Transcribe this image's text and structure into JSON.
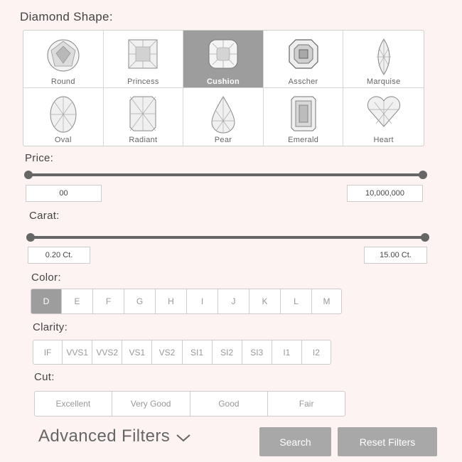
{
  "shape": {
    "title": "Diamond Shape:",
    "items": [
      {
        "label": "Round",
        "icon": "round-diamond-icon"
      },
      {
        "label": "Princess",
        "icon": "princess-diamond-icon"
      },
      {
        "label": "Cushion",
        "icon": "cushion-diamond-icon",
        "selected": true
      },
      {
        "label": "Asscher",
        "icon": "asscher-diamond-icon"
      },
      {
        "label": "Marquise",
        "icon": "marquise-diamond-icon"
      },
      {
        "label": "Oval",
        "icon": "oval-diamond-icon"
      },
      {
        "label": "Radiant",
        "icon": "radiant-diamond-icon"
      },
      {
        "label": "Pear",
        "icon": "pear-diamond-icon"
      },
      {
        "label": "Emerald",
        "icon": "emerald-diamond-icon"
      },
      {
        "label": "Heart",
        "icon": "heart-diamond-icon"
      }
    ]
  },
  "price": {
    "title": "Price:",
    "min_value": "00",
    "max_value": "10,000,000"
  },
  "carat": {
    "title": "Carat:",
    "min_value": "0.20 Ct.",
    "max_value": "15.00 Ct."
  },
  "color": {
    "title": "Color:",
    "options": [
      "D",
      "E",
      "F",
      "G",
      "H",
      "I",
      "J",
      "K",
      "L",
      "M"
    ],
    "selected": "D"
  },
  "clarity": {
    "title": "Clarity:",
    "options": [
      "IF",
      "VVS1",
      "VVS2",
      "VS1",
      "VS2",
      "SI1",
      "SI2",
      "SI3",
      "I1",
      "I2"
    ]
  },
  "cut": {
    "title": "Cut:",
    "options": [
      "Excellent",
      "Very Good",
      "Good",
      "Fair"
    ]
  },
  "advanced": {
    "label": "Advanced Filters",
    "icon": "chevron-down-icon"
  },
  "actions": {
    "search_label": "Search",
    "reset_label": "Reset Filters"
  },
  "colors": {
    "background": "#fdf3f3",
    "selected": "#9d9d9d",
    "slider": "#666666",
    "button": "#a8a8a8"
  }
}
